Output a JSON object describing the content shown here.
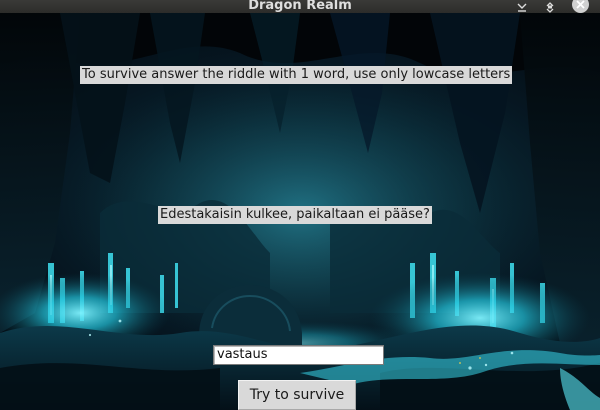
{
  "window": {
    "title": "Dragon Realm",
    "controls": {
      "minimize_icon": "minimize-icon",
      "maximize_icon": "maximize-icon",
      "close_icon": "close-icon"
    }
  },
  "game": {
    "instructions": "To survive answer the riddle with 1 word, use only lowcase letters",
    "riddle": "Edestakaisin kulkee, paikaltaan ei pääse?",
    "answer_input": {
      "value": "vastaus"
    },
    "submit_label": "Try to survive"
  },
  "colors": {
    "label_background": "#d9d9d9",
    "cave_glow": "#2fd3e8",
    "cave_dark": "#061722"
  }
}
